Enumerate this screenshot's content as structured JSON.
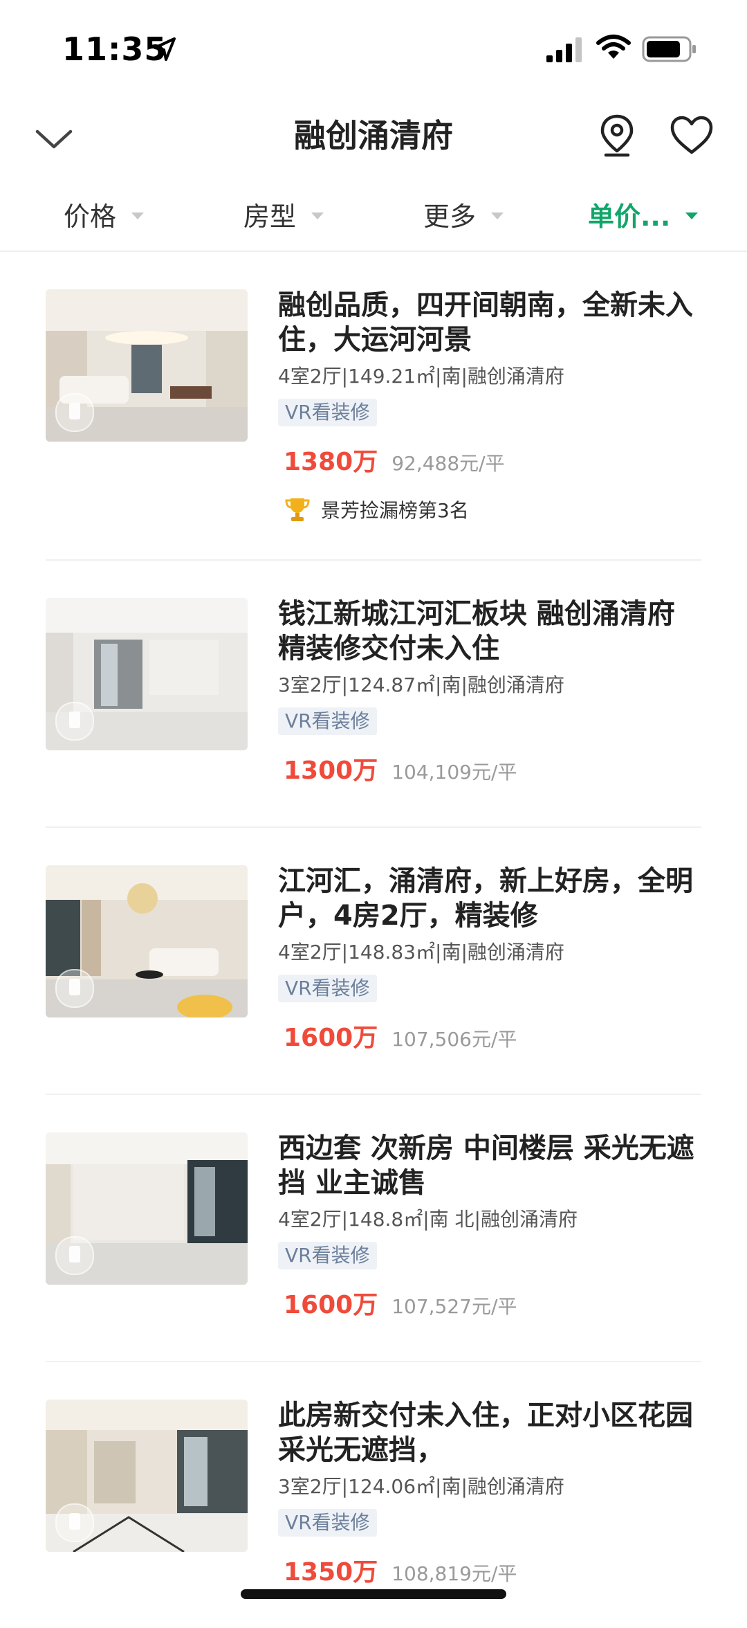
{
  "status_bar": {
    "time": "11:35"
  },
  "header": {
    "title": "融创涌清府"
  },
  "filters": [
    {
      "label": "价格",
      "active": false
    },
    {
      "label": "房型",
      "active": false
    },
    {
      "label": "更多",
      "active": false
    },
    {
      "label": "单价...",
      "active": true
    }
  ],
  "listings": [
    {
      "title": "融创品质，四开间朝南，全新未入住，大运河河景",
      "specs": "4室2厅|149.21㎡|南|融创涌清府",
      "tag": "VR看装修",
      "price": "1380万",
      "unit_price": "92,488元/平",
      "rank": "景芳捡漏榜第3名"
    },
    {
      "title": "钱江新城江河汇板块 融创涌清府 精装修交付未入住",
      "specs": "3室2厅|124.87㎡|南|融创涌清府",
      "tag": "VR看装修",
      "price": "1300万",
      "unit_price": "104,109元/平"
    },
    {
      "title": "江河汇，涌清府，新上好房，全明户，4房2厅，精装修",
      "specs": "4室2厅|148.83㎡|南|融创涌清府",
      "tag": "VR看装修",
      "price": "1600万",
      "unit_price": "107,506元/平"
    },
    {
      "title": "西边套 次新房 中间楼层 采光无遮挡 业主诚售",
      "specs": "4室2厅|148.8㎡|南 北|融创涌清府",
      "tag": "VR看装修",
      "price": "1600万",
      "unit_price": "107,527元/平"
    },
    {
      "title": "此房新交付未入住，正对小区花园采光无遮挡，",
      "specs": "3室2厅|124.06㎡|南|融创涌清府",
      "tag": "VR看装修",
      "price": "1350万",
      "unit_price": "108,819元/平"
    }
  ],
  "colors": {
    "accent": "#11a56a",
    "price": "#f04a3a",
    "tag_text": "#6c7f9b",
    "tag_bg": "#eef2f6"
  },
  "icons": {
    "back": "chevron-down-icon",
    "map": "location-pin-icon",
    "favorite": "heart-icon",
    "rank": "trophy-icon"
  }
}
